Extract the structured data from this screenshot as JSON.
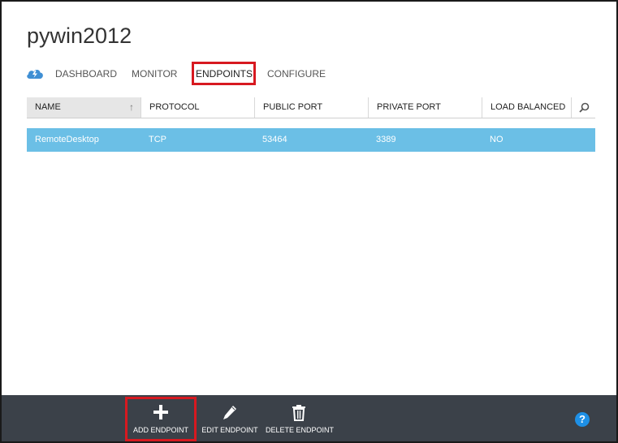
{
  "page": {
    "title": "pywin2012"
  },
  "nav": {
    "tabs": [
      {
        "label": "DASHBOARD"
      },
      {
        "label": "MONITOR"
      },
      {
        "label": "ENDPOINTS"
      },
      {
        "label": "CONFIGURE"
      }
    ],
    "active": "ENDPOINTS",
    "icon": "cloud-lightning-icon"
  },
  "grid": {
    "columns": [
      "NAME",
      "PROTOCOL",
      "PUBLIC PORT",
      "PRIVATE PORT",
      "LOAD BALANCED"
    ],
    "sort_indicator": "↑",
    "rows": [
      {
        "name": "RemoteDesktop",
        "protocol": "TCP",
        "public_port": "53464",
        "private_port": "3389",
        "load_balanced": "NO"
      }
    ]
  },
  "commands": {
    "add": {
      "label": "ADD ENDPOINT",
      "icon": "plus-icon"
    },
    "edit": {
      "label": "EDIT ENDPOINT",
      "icon": "pencil-icon"
    },
    "delete": {
      "label": "DELETE ENDPOINT",
      "icon": "trash-icon"
    },
    "help": {
      "label": "?",
      "icon": "help-icon"
    }
  },
  "colors": {
    "selected_row": "#6bbfe6",
    "command_bar": "#3b4149",
    "highlight": "#d71920",
    "help": "#1e90e6"
  }
}
